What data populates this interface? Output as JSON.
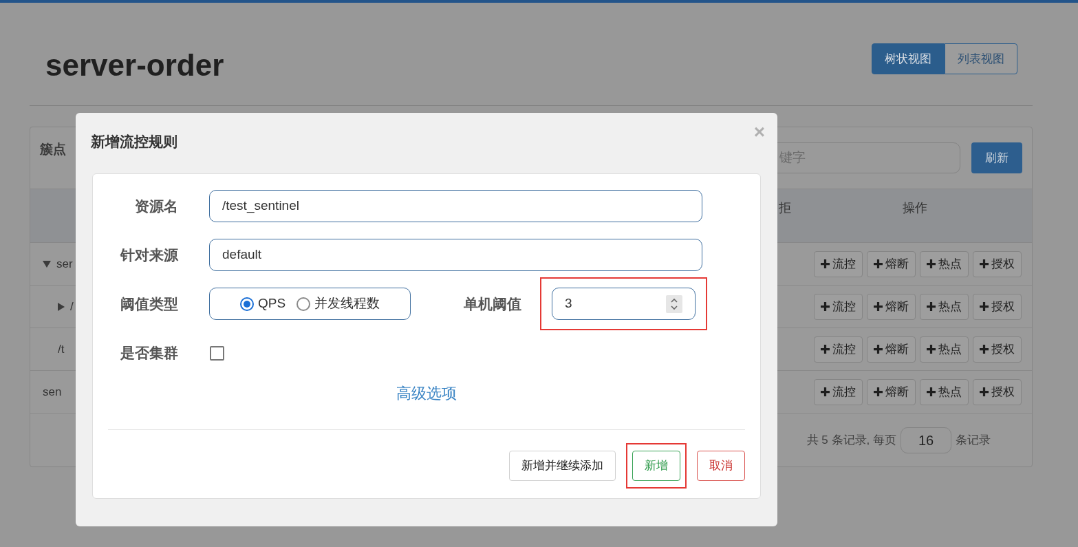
{
  "page": {
    "title": "server-order"
  },
  "view_tabs": [
    {
      "label": "树状视图",
      "selected": true
    },
    {
      "label": "列表视图",
      "selected": false
    }
  ],
  "panel": {
    "title": "簇点",
    "search": {
      "placeholder": "键字"
    },
    "refresh_button": "刷新",
    "columns": [
      "拒",
      "操作"
    ],
    "tree": [
      {
        "label": "ser",
        "expanded": true,
        "actions": [
          "流控",
          "熔断",
          "热点",
          "授权"
        ],
        "children": [
          {
            "label": "/",
            "expanded": false,
            "actions": [
              "流控",
              "熔断",
              "热点",
              "授权"
            ]
          },
          {
            "label": "/t",
            "actions": [
              "流控",
              "熔断",
              "热点",
              "授权"
            ]
          }
        ]
      },
      {
        "label": "sen",
        "actions": [
          "流控",
          "熔断",
          "热点",
          "授权"
        ]
      }
    ],
    "pagination": {
      "prefix": "共 5 条记录, 每页",
      "page_size": "16",
      "suffix": "条记录"
    }
  },
  "dialog": {
    "title": "新增流控规则",
    "close": "×",
    "resource": {
      "label": "资源名",
      "value": "/test_sentinel"
    },
    "source": {
      "label": "针对来源",
      "value": "default"
    },
    "threshold_type": {
      "label": "阈值类型",
      "options": [
        {
          "label": "QPS",
          "selected": true
        },
        {
          "label": "并发线程数",
          "selected": false
        }
      ]
    },
    "threshold": {
      "label": "单机阈值",
      "value": "3",
      "highlighted": true
    },
    "cluster": {
      "label": "是否集群",
      "checked": false
    },
    "advanced_link": "高级选项",
    "buttons": [
      {
        "label": "新增并继续添加",
        "kind": "default",
        "highlighted": false
      },
      {
        "label": "新增",
        "kind": "success",
        "highlighted": true
      },
      {
        "label": "取消",
        "kind": "danger",
        "highlighted": false
      }
    ]
  }
}
